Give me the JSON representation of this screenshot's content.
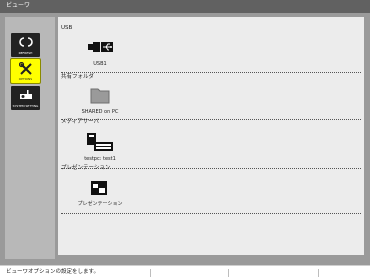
{
  "window": {
    "title": "ビューワ"
  },
  "sidebar": {
    "items": [
      {
        "label": "REFRESH",
        "icon": "refresh-icon"
      },
      {
        "label": "OPTIONS",
        "icon": "tools-icon",
        "active": true
      },
      {
        "label": "SYSTEM SETTING",
        "icon": "projector-icon"
      }
    ]
  },
  "sections": [
    {
      "label": "USB",
      "item_label": "USB1",
      "icon": "usb-icon"
    },
    {
      "label": "共有フォルダ",
      "item_label": "SHARED on PC",
      "icon": "folder-icon"
    },
    {
      "label": "メディアサーバ",
      "item_label": "testpc: test1",
      "icon": "media-server-icon"
    },
    {
      "label": "プレゼンテーション",
      "item_label": "プレゼンテーション",
      "icon": "presentation-icon"
    }
  ],
  "status": {
    "message": "ビューワオプションの設定をします。"
  },
  "colors": {
    "titlebar": "#616161",
    "frame": "#9a9a9a",
    "panel": "#ececec",
    "highlight": "#ffff00"
  }
}
